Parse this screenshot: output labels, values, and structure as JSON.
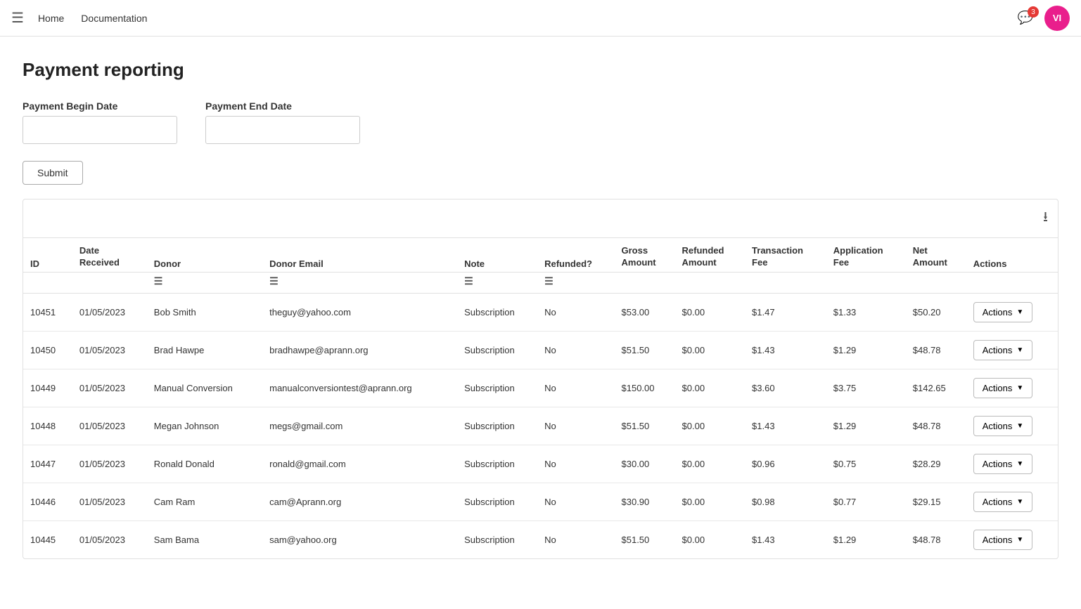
{
  "nav": {
    "home_label": "Home",
    "docs_label": "Documentation",
    "notification_count": "3",
    "avatar_initials": "VI"
  },
  "page": {
    "title": "Payment reporting"
  },
  "form": {
    "begin_date_label": "Payment Begin Date",
    "begin_date_placeholder": "",
    "end_date_label": "Payment End Date",
    "end_date_placeholder": "",
    "submit_label": "Submit"
  },
  "table": {
    "download_icon": "⬇",
    "columns": {
      "id": "ID",
      "date_received": "Date Received",
      "donor": "Donor",
      "donor_email": "Donor Email",
      "note": "Note",
      "refunded": "Refunded?",
      "gross_amount": "Gross Amount",
      "refunded_amount": "Refunded Amount",
      "transaction_fee": "Transaction Fee",
      "application_fee": "Application Fee",
      "net_amount": "Net Amount",
      "actions": "Actions"
    },
    "rows": [
      {
        "id": "10451",
        "date_received": "01/05/2023",
        "donor": "Bob Smith",
        "donor_email": "theguy@yahoo.com",
        "note": "Subscription",
        "refunded": "No",
        "gross_amount": "$53.00",
        "refunded_amount": "$0.00",
        "transaction_fee": "$1.47",
        "application_fee": "$1.33",
        "net_amount": "$50.20",
        "actions": "Actions"
      },
      {
        "id": "10450",
        "date_received": "01/05/2023",
        "donor": "Brad Hawpe",
        "donor_email": "bradhawpe@aprann.org",
        "note": "Subscription",
        "refunded": "No",
        "gross_amount": "$51.50",
        "refunded_amount": "$0.00",
        "transaction_fee": "$1.43",
        "application_fee": "$1.29",
        "net_amount": "$48.78",
        "actions": "Actions"
      },
      {
        "id": "10449",
        "date_received": "01/05/2023",
        "donor": "Manual Conversion",
        "donor_email": "manualconversiontest@aprann.org",
        "note": "Subscription",
        "refunded": "No",
        "gross_amount": "$150.00",
        "refunded_amount": "$0.00",
        "transaction_fee": "$3.60",
        "application_fee": "$3.75",
        "net_amount": "$142.65",
        "actions": "Actions"
      },
      {
        "id": "10448",
        "date_received": "01/05/2023",
        "donor": "Megan Johnson",
        "donor_email": "megs@gmail.com",
        "note": "Subscription",
        "refunded": "No",
        "gross_amount": "$51.50",
        "refunded_amount": "$0.00",
        "transaction_fee": "$1.43",
        "application_fee": "$1.29",
        "net_amount": "$48.78",
        "actions": "Actions"
      },
      {
        "id": "10447",
        "date_received": "01/05/2023",
        "donor": "Ronald Donald",
        "donor_email": "ronald@gmail.com",
        "note": "Subscription",
        "refunded": "No",
        "gross_amount": "$30.00",
        "refunded_amount": "$0.00",
        "transaction_fee": "$0.96",
        "application_fee": "$0.75",
        "net_amount": "$28.29",
        "actions": "Actions"
      },
      {
        "id": "10446",
        "date_received": "01/05/2023",
        "donor": "Cam Ram",
        "donor_email": "cam@Aprann.org",
        "note": "Subscription",
        "refunded": "No",
        "gross_amount": "$30.90",
        "refunded_amount": "$0.00",
        "transaction_fee": "$0.98",
        "application_fee": "$0.77",
        "net_amount": "$29.15",
        "actions": "Actions"
      },
      {
        "id": "10445",
        "date_received": "01/05/2023",
        "donor": "Sam Bama",
        "donor_email": "sam@yahoo.org",
        "note": "Subscription",
        "refunded": "No",
        "gross_amount": "$51.50",
        "refunded_amount": "$0.00",
        "transaction_fee": "$1.43",
        "application_fee": "$1.29",
        "net_amount": "$48.78",
        "actions": "Actions"
      }
    ]
  }
}
